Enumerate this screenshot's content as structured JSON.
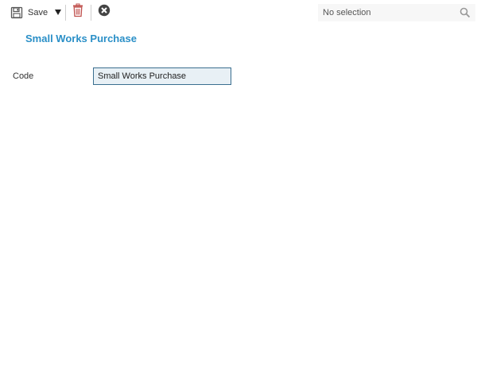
{
  "toolbar": {
    "save_label": "Save",
    "icons": {
      "save": "floppy-disk-icon",
      "dropdown": "caret-down-icon",
      "delete": "trash-icon",
      "cancel": "close-circle-icon"
    },
    "colors": {
      "delete_icon": "#c0504d",
      "cancel_icon": "#444444"
    }
  },
  "selection": {
    "placeholder": "No selection",
    "value": ""
  },
  "page": {
    "title": "Small Works Purchase",
    "title_color": "#2a8fc7"
  },
  "form": {
    "code_label": "Code",
    "code_value": "Small Works Purchase"
  }
}
